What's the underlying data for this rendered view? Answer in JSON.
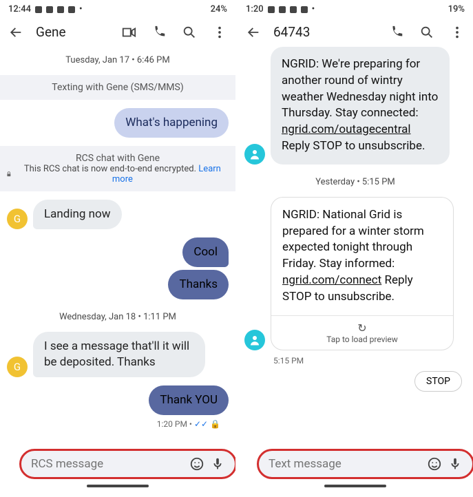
{
  "left": {
    "status": {
      "time": "12:44",
      "battery": "24%"
    },
    "header": {
      "title": "Gene"
    },
    "date1": "Tuesday, Jan 17 • 6:46 PM",
    "banner_sms": "Texting with Gene (SMS/MMS)",
    "msg_whats": "What's happening",
    "rcs_line1": "RCS chat with Gene",
    "rcs_line2a": "This RCS chat is now end-to-end encrypted. ",
    "rcs_line2b": "Learn more",
    "avatar_initial": "G",
    "msg_landing": "Landing now",
    "msg_cool": "Cool",
    "msg_thanks": "Thanks",
    "date2": "Wednesday, Jan 18 • 1:11 PM",
    "msg_deposit": "I see a message that'll it will be deposited. Thanks",
    "msg_thankyou": "Thank YOU",
    "meta_time": "1:20 PM •",
    "input_placeholder": "RCS message"
  },
  "right": {
    "status": {
      "time": "1:20",
      "battery": "19%"
    },
    "header": {
      "title": "64743"
    },
    "msg_prep": "NGRID: We're preparing for another round of wintry weather Wednesday night into Thursday. Stay connected: ",
    "link1": "ngrid.com/outagecentral",
    "msg_prep_tail": " Reply STOP to unsubscribe.",
    "date1": "Yesterday • 5:15 PM",
    "card_body_a": "NGRID: National Grid is prepared for a winter storm expected tonight through Friday. Stay informed: ",
    "link2": "ngrid.com/connect",
    "card_body_b": " Reply STOP to unsubscribe.",
    "card_foot": "Tap to load preview",
    "time_small": "5:15 PM",
    "suggest_stop": "STOP",
    "input_placeholder": "Text message"
  }
}
